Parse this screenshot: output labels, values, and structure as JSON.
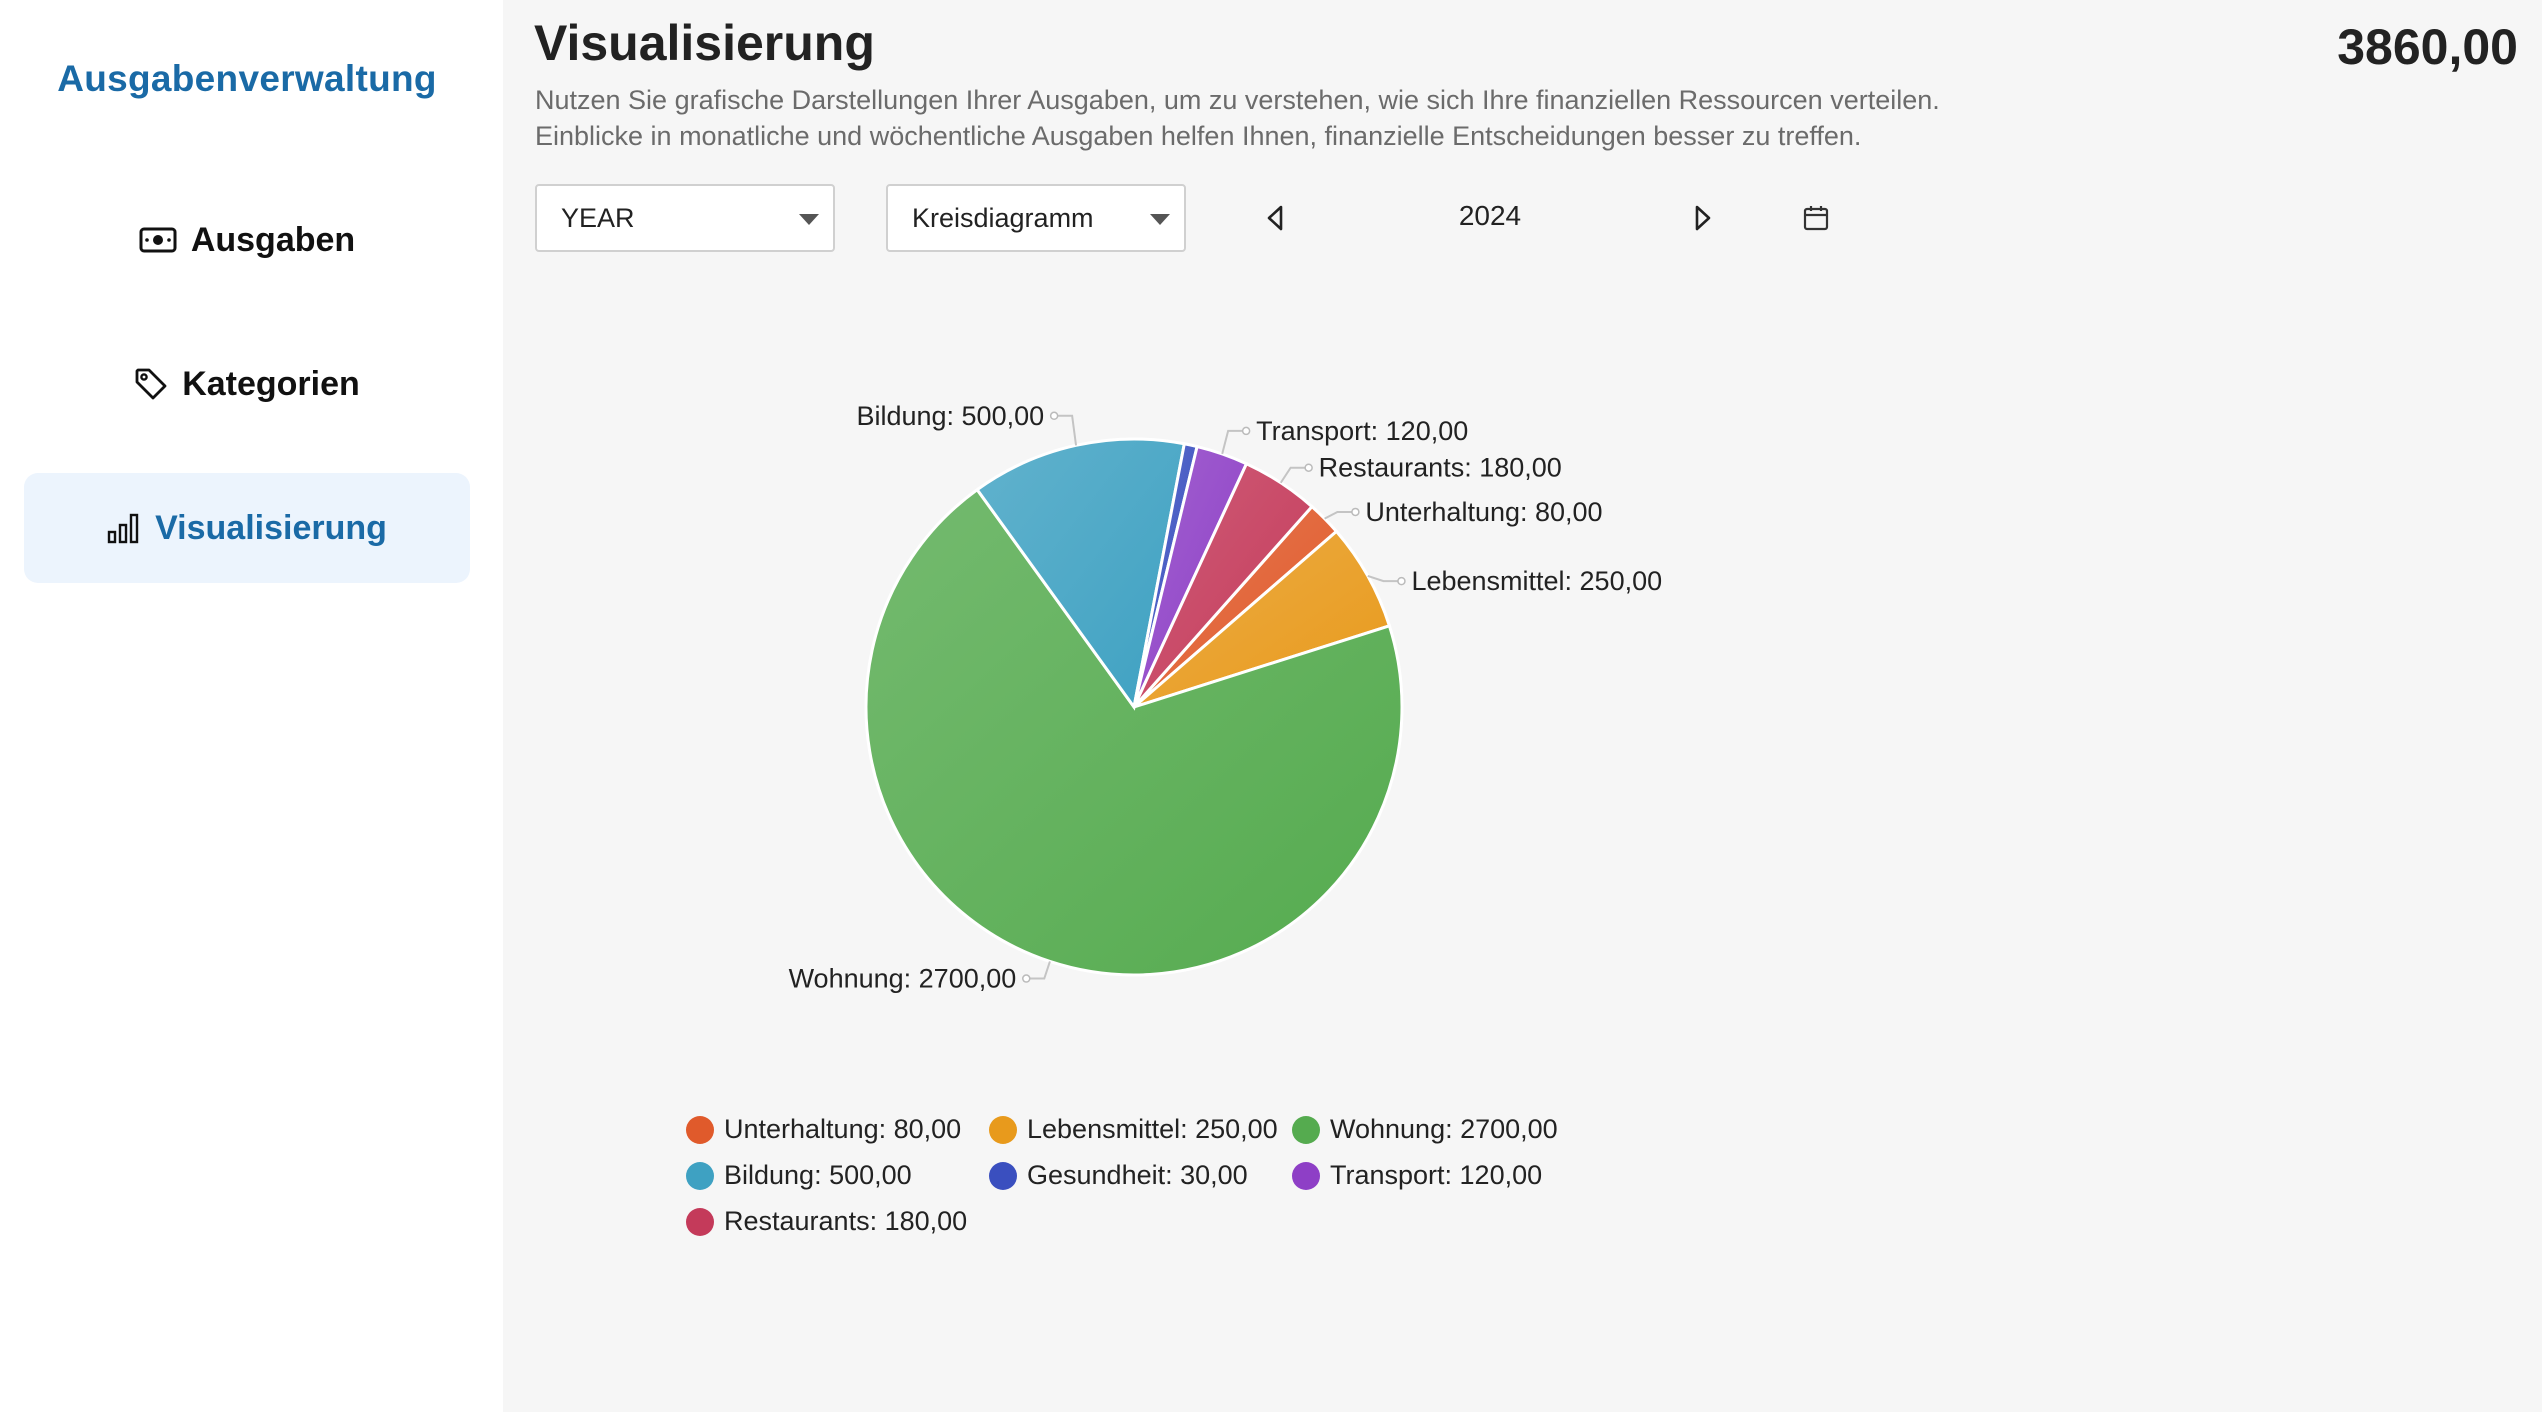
{
  "sidebar": {
    "brand": "Ausgabenverwaltung",
    "items": [
      {
        "label": "Ausgaben",
        "icon": "cash-icon",
        "active": false
      },
      {
        "label": "Kategorien",
        "icon": "tag-icon",
        "active": false
      },
      {
        "label": "Visualisierung",
        "icon": "bar-chart-icon",
        "active": true
      }
    ]
  },
  "header": {
    "title": "Visualisierung",
    "total": "3860,00",
    "description_line1": "Nutzen Sie grafische Darstellungen Ihrer Ausgaben, um zu verstehen, wie sich Ihre finanziellen Ressourcen verteilen.",
    "description_line2": "Einblicke in monatliche und wöchentliche Ausgaben helfen Ihnen, finanzielle Entscheidungen besser zu treffen."
  },
  "controls": {
    "period_select": "YEAR",
    "chart_type_select": "Kreisdiagramm",
    "year": "2024",
    "prev_icon": "caret-left-icon",
    "next_icon": "caret-right-icon",
    "calendar_icon": "calendar-icon"
  },
  "chart_data": {
    "type": "pie",
    "slices": [
      {
        "label": "Unterhaltung",
        "value": 80,
        "display": "Unterhaltung: 80,00",
        "color": "#e05a2b"
      },
      {
        "label": "Lebensmittel",
        "value": 250,
        "display": "Lebensmittel: 250,00",
        "color": "#e89a1c"
      },
      {
        "label": "Wohnung",
        "value": 2700,
        "display": "Wohnung: 2700,00",
        "color": "#55ab4f"
      },
      {
        "label": "Bildung",
        "value": 500,
        "display": "Bildung: 500,00",
        "color": "#3ea1c2"
      },
      {
        "label": "Gesundheit",
        "value": 30,
        "display": "Gesundheit: 30,00",
        "color": "#3a4fbf"
      },
      {
        "label": "Transport",
        "value": 120,
        "display": "Transport: 120,00",
        "color": "#8e3fc6"
      },
      {
        "label": "Restaurants",
        "value": 180,
        "display": "Restaurants: 180,00",
        "color": "#c43a5a"
      }
    ],
    "legend": [
      {
        "label": "Unterhaltung: 80,00",
        "color": "#e05a2b"
      },
      {
        "label": "Lebensmittel: 250,00",
        "color": "#e89a1c"
      },
      {
        "label": "Wohnung: 2700,00",
        "color": "#55ab4f"
      },
      {
        "label": "Bildung: 500,00",
        "color": "#3ea1c2"
      },
      {
        "label": "Gesundheit: 30,00",
        "color": "#3a4fbf"
      },
      {
        "label": "Transport: 120,00",
        "color": "#8e3fc6"
      },
      {
        "label": "Restaurants: 180,00",
        "color": "#c43a5a"
      }
    ],
    "legend_position": "bottom"
  },
  "colors": {
    "accent": "#1a6aa6",
    "active_bg": "#ecf4fd"
  }
}
